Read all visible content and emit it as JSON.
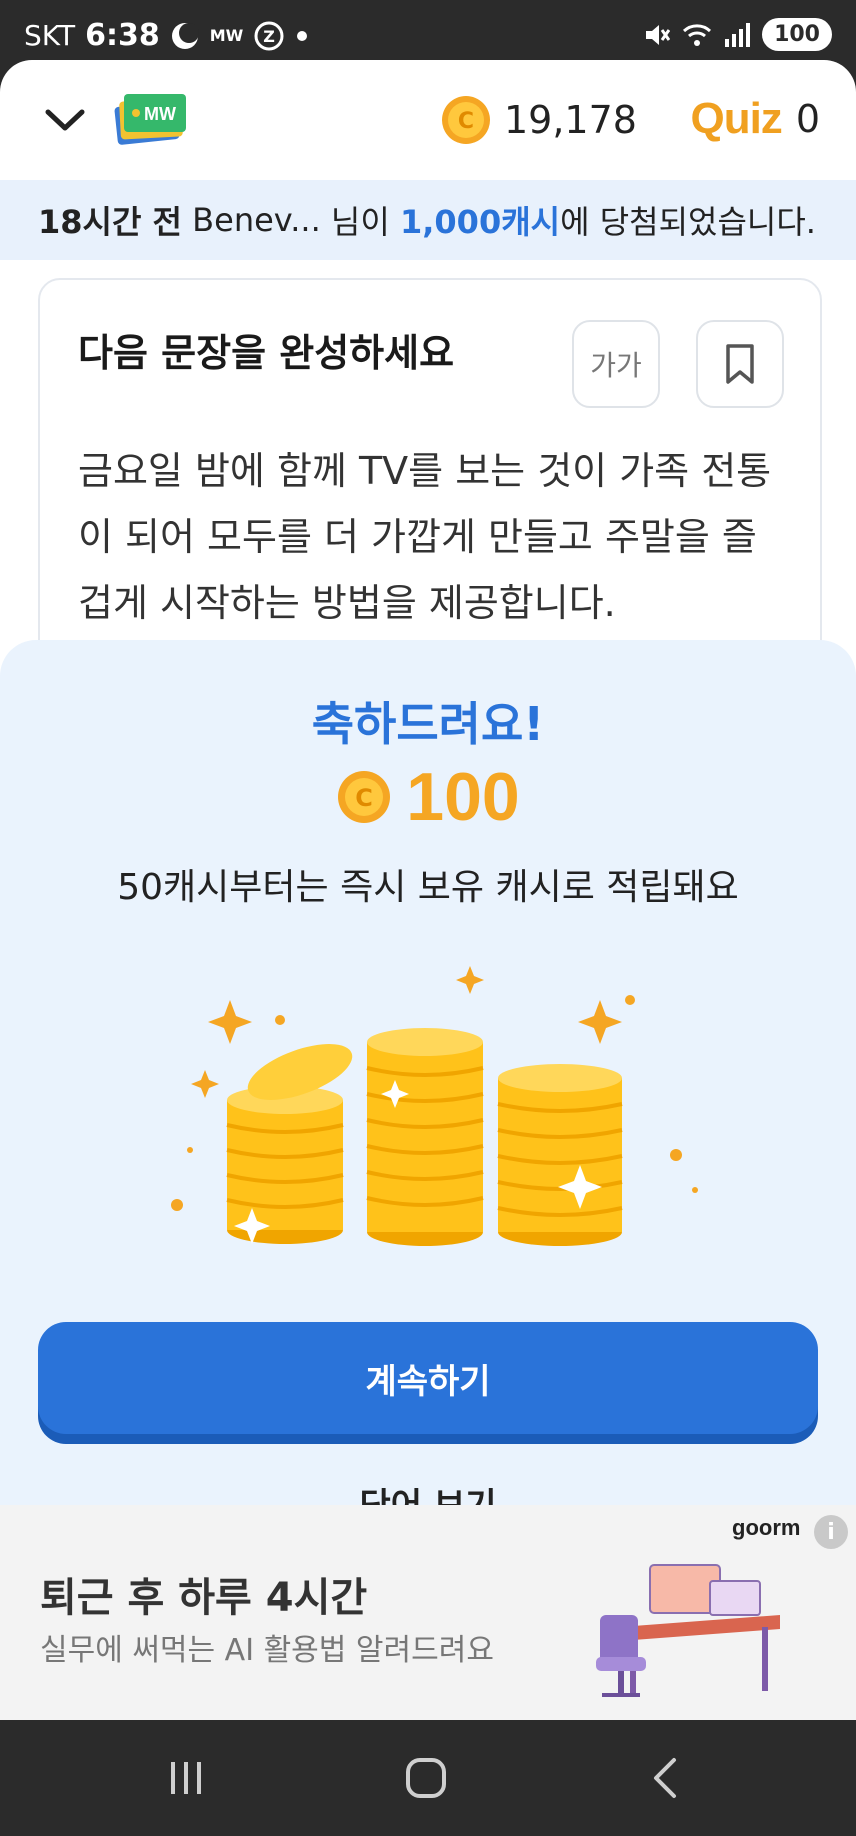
{
  "status_bar": {
    "carrier": "SKT",
    "time": "6:38",
    "battery": "100",
    "icons": [
      "moon-icon",
      "mw-icon",
      "z-icon",
      "dot-icon",
      "mute-icon",
      "wifi-icon",
      "signal-icon"
    ]
  },
  "header": {
    "coin_count": "19,178",
    "quiz_logo": "Quiz",
    "quiz_count": "0",
    "logo_text": "MW"
  },
  "ticker": {
    "time_ago": "18시간 전",
    "user": "Benev...",
    "middle": "님이",
    "amount": "1,000캐시",
    "end": "에 당첨되었습니다."
  },
  "question_card": {
    "title": "다음 문장을 완성하세요",
    "font_button": "가가",
    "text": "금요일 밤에 함께 TV를 보는 것이 가족 전통이 되어 모두를 더 가깝게 만들고 주말을 즐겁게 시작하는 방법을 제공합니다."
  },
  "reward_sheet": {
    "title": "축하드려요!",
    "amount": "100",
    "description": "50캐시부터는 즉시 보유 캐시로 적립돼요",
    "continue_label": "계속하기",
    "word_view_label": "단어 보기"
  },
  "ad": {
    "brand": "goorm",
    "info": "i",
    "title": "퇴근 후 하루 4시간",
    "subtitle": "실무에 써먹는 AI 활용법 알려드려요"
  },
  "colors": {
    "primary_blue": "#2a73d9",
    "coin_gold": "#f5a623",
    "sheet_bg": "#eaf3fd"
  }
}
